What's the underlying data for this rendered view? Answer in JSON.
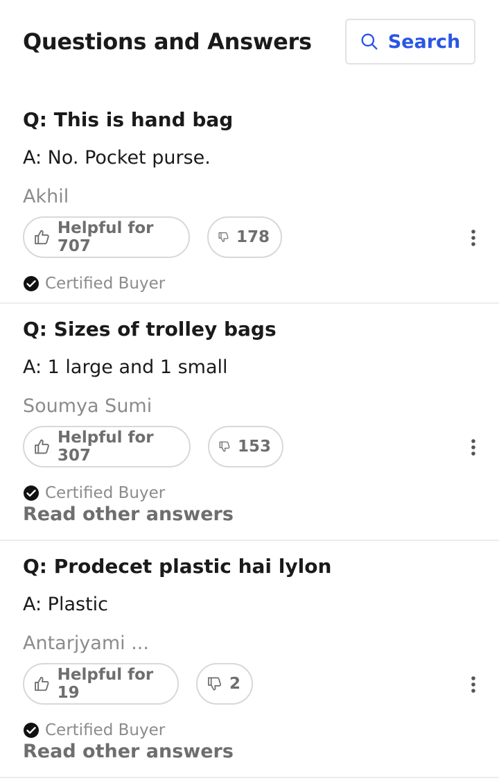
{
  "header": {
    "title": "Questions and Answers",
    "search_label": "Search"
  },
  "items": [
    {
      "question": "Q: This is hand bag",
      "answer": "A: No. Pocket purse.",
      "author": "Akhil",
      "helpful": "Helpful for 707",
      "not_helpful": "178",
      "certified": "Certified Buyer",
      "read_more": ""
    },
    {
      "question": "Q: Sizes of trolley bags",
      "answer": "A: 1 large and 1 small",
      "author": "Soumya Sumi",
      "helpful": "Helpful for 307",
      "not_helpful": "153",
      "certified": "Certified Buyer",
      "read_more": "Read other answers"
    },
    {
      "question": "Q: Prodecet plastic hai lylon",
      "answer": "A: Plastic",
      "author": "Antarjyami ...",
      "helpful": "Helpful for 19",
      "not_helpful": "2",
      "certified": "Certified Buyer",
      "read_more": "Read other answers"
    }
  ],
  "icons": {
    "search": "search-icon",
    "thumbs_up": "thumbs-up-icon",
    "thumbs_down": "thumbs-down-icon",
    "more": "more-vertical-icon",
    "check": "check-circle-icon"
  },
  "colors": {
    "accent": "#2a55e5",
    "muted": "#8b8b8b"
  }
}
